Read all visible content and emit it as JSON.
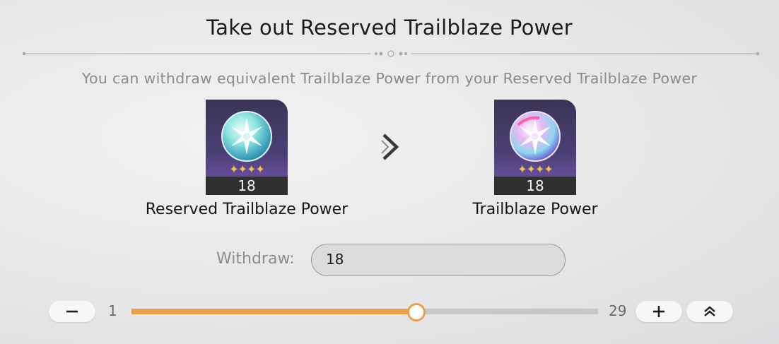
{
  "title": "Take out Reserved Trailblaze Power",
  "subtitle": "You can withdraw equivalent Trailblaze Power from your Reserved Trailblaze Power",
  "source_item": {
    "label": "Reserved Trailblaze Power",
    "count": "18",
    "stars": "✦✦✦✦",
    "icon": "reserved-power-orb-icon"
  },
  "target_item": {
    "label": "Trailblaze Power",
    "count": "18",
    "stars": "✦✦✦✦",
    "icon": "trailblaze-power-orb-icon"
  },
  "arrow_icon": "chevron-right-icon",
  "withdraw": {
    "label": "Withdraw:",
    "value": "18"
  },
  "slider": {
    "min": "1",
    "max": "29",
    "value": 18
  },
  "buttons": {
    "decrease": "minus-icon",
    "increase": "plus-icon",
    "max": "double-chevron-up-icon"
  },
  "colors": {
    "accent": "#e8a04a",
    "card_bg": "#4a3f73",
    "track": "#c7c7c9"
  }
}
